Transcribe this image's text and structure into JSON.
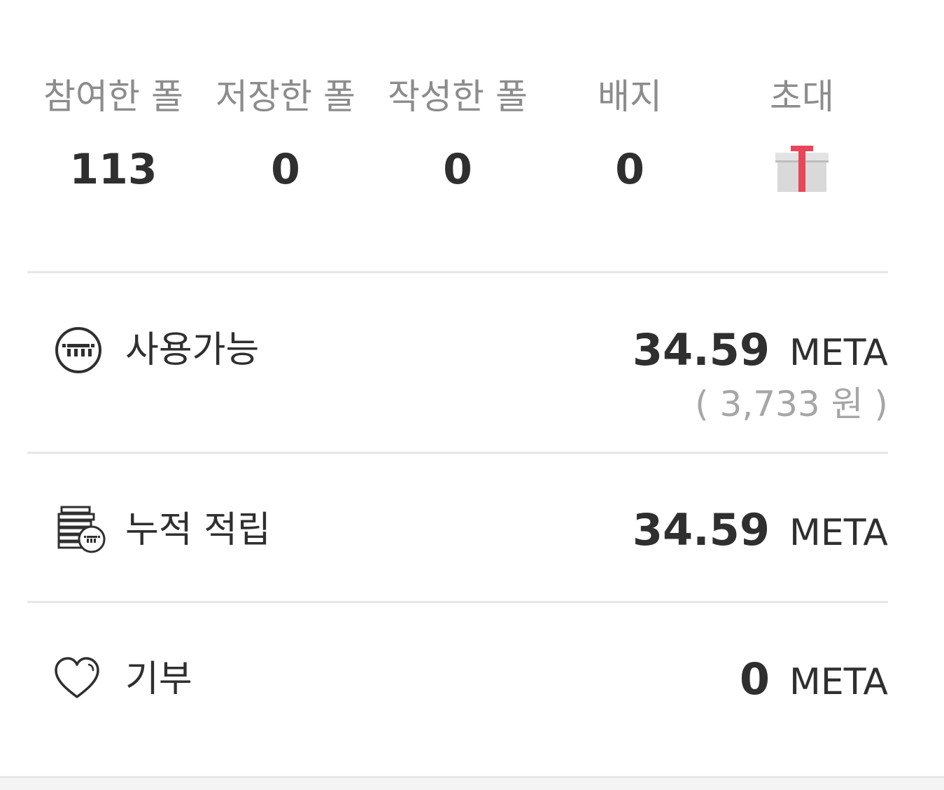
{
  "stats": [
    {
      "label": "참여한 폴",
      "value": "113"
    },
    {
      "label": "저장한 폴",
      "value": "0"
    },
    {
      "label": "작성한 폴",
      "value": "0"
    },
    {
      "label": "배지",
      "value": "0"
    },
    {
      "label": "초대",
      "icon": "gift-icon"
    }
  ],
  "wallet": {
    "available": {
      "icon": "meta-coin-icon",
      "label": "사용가능",
      "amount": "34.59",
      "unit": "META",
      "krw": "( 3,733 원 )"
    },
    "accumulated": {
      "icon": "coin-stack-icon",
      "label": "누적 적립",
      "amount": "34.59",
      "unit": "META"
    },
    "donation": {
      "icon": "heart-icon",
      "label": "기부",
      "amount": "0",
      "unit": "META"
    }
  },
  "colors": {
    "label_gray": "#8c8c8c",
    "text_dark": "#2f2f2f",
    "krw_gray": "#a6a6a6",
    "divider": "#e6e6e6",
    "gift_ribbon": "#e8455a",
    "gift_box": "#d9d9d9"
  }
}
